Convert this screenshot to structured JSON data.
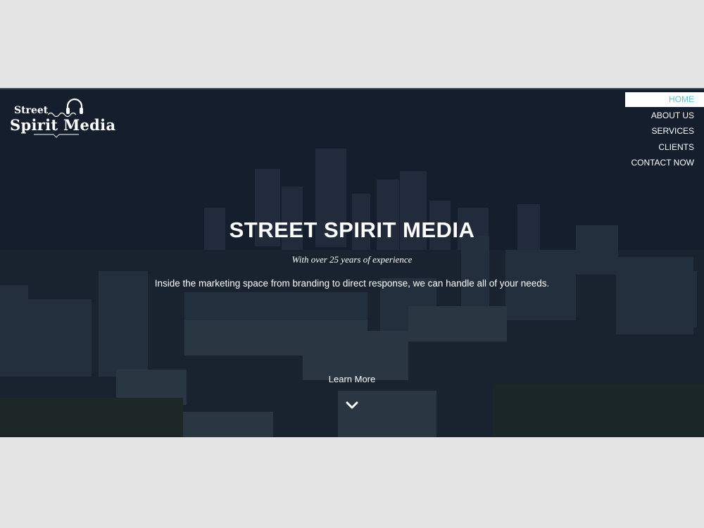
{
  "logo": {
    "line1": "Street",
    "line2": "Spirit Media"
  },
  "nav": {
    "items": [
      {
        "label": "HOME"
      },
      {
        "label": "ABOUT US"
      },
      {
        "label": "SERVICES"
      },
      {
        "label": "CLIENTS"
      },
      {
        "label": "CONTACT NOW"
      }
    ],
    "active_color": "#5fc3d6"
  },
  "hero": {
    "title": "STREET SPIRIT MEDIA",
    "subtitle": "With over 25 years of experience",
    "description": "Inside the marketing space from branding to direct response, we can handle all of your needs.",
    "cta_label": "Learn More",
    "cta_icon": "chevron-down-icon"
  },
  "colors": {
    "page_background": "#e4e4e4",
    "hero_overlay": "#1a2434",
    "text": "#ffffff"
  }
}
